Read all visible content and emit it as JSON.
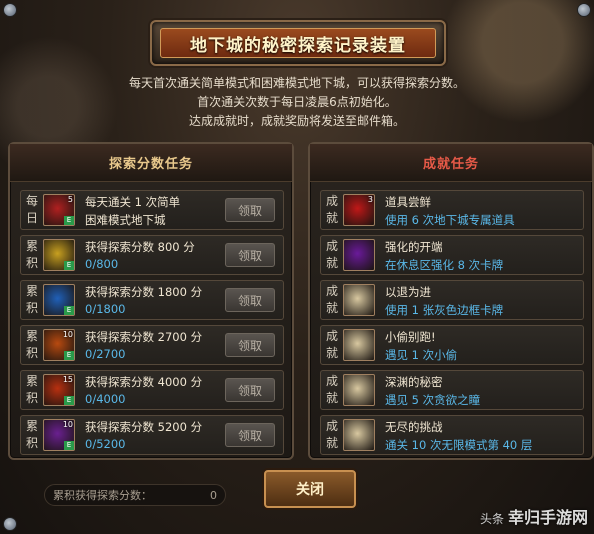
{
  "title": "地下城的秘密探索记录装置",
  "description": [
    "每天首次通关简单模式和困难模式地下城，可以获得探索分数。",
    "首次通关次数于每日凌晨6点初始化。",
    "达成成就时，成就奖励将发送至邮件箱。"
  ],
  "left_panel": {
    "header": "探索分数任务",
    "rows": [
      {
        "tag": "每日",
        "line1": "每天通关 1 次简单",
        "line2": "困难模式地下城",
        "badge": "5",
        "button": "领取",
        "line2_color": "#f0e6d2",
        "icon_color": "#b02020"
      },
      {
        "tag": "累积",
        "line1": "获得探索分数 800 分",
        "line2": "0/800",
        "badge": "",
        "button": "领取",
        "line2_color": "#5ab8e8",
        "icon_color": "#c8a020"
      },
      {
        "tag": "累积",
        "line1": "获得探索分数 1800 分",
        "line2": "0/1800",
        "badge": "",
        "button": "领取",
        "line2_color": "#5ab8e8",
        "icon_color": "#2060b8"
      },
      {
        "tag": "累积",
        "line1": "获得探索分数 2700 分",
        "line2": "0/2700",
        "badge": "10",
        "button": "领取",
        "line2_color": "#5ab8e8",
        "icon_color": "#b84a10"
      },
      {
        "tag": "累积",
        "line1": "获得探索分数 4000 分",
        "line2": "0/4000",
        "badge": "15",
        "button": "领取",
        "line2_color": "#5ab8e8",
        "icon_color": "#b83010"
      },
      {
        "tag": "累积",
        "line1": "获得探索分数 5200 分",
        "line2": "0/5200",
        "badge": "10",
        "button": "领取",
        "line2_color": "#5ab8e8",
        "icon_color": "#6a2090"
      }
    ]
  },
  "right_panel": {
    "header": "成就任务",
    "rows": [
      {
        "tag": "成就",
        "line1": "道具尝鲜",
        "line2": "使用 6 次地下城专属道具",
        "badge": "3",
        "icon_color": "#c01818"
      },
      {
        "tag": "成就",
        "line1": "强化的开端",
        "line2": "在休息区强化 8 次卡牌",
        "badge": "",
        "icon_color": "#6a1a9a"
      },
      {
        "tag": "成就",
        "line1": "以退为进",
        "line2": "使用 1 张灰色边框卡牌",
        "badge": "",
        "icon_color": "#d8c8a0"
      },
      {
        "tag": "成就",
        "line1": "小偷别跑!",
        "line2": "遇见 1 次小偷",
        "badge": "",
        "icon_color": "#d8c8a0"
      },
      {
        "tag": "成就",
        "line1": "深渊的秘密",
        "line2": "遇见 5 次贪欲之瞳",
        "badge": "",
        "icon_color": "#d8c8a0"
      },
      {
        "tag": "成就",
        "line1": "无尽的挑战",
        "line2": "通关 10 次无限模式第 40 层",
        "badge": "",
        "icon_color": "#d8c8a0"
      }
    ]
  },
  "score": {
    "label": "累积获得探索分数：",
    "value": "0"
  },
  "close_button": "关闭",
  "watermark": {
    "prefix": "头条",
    "text": "幸归手游网"
  }
}
